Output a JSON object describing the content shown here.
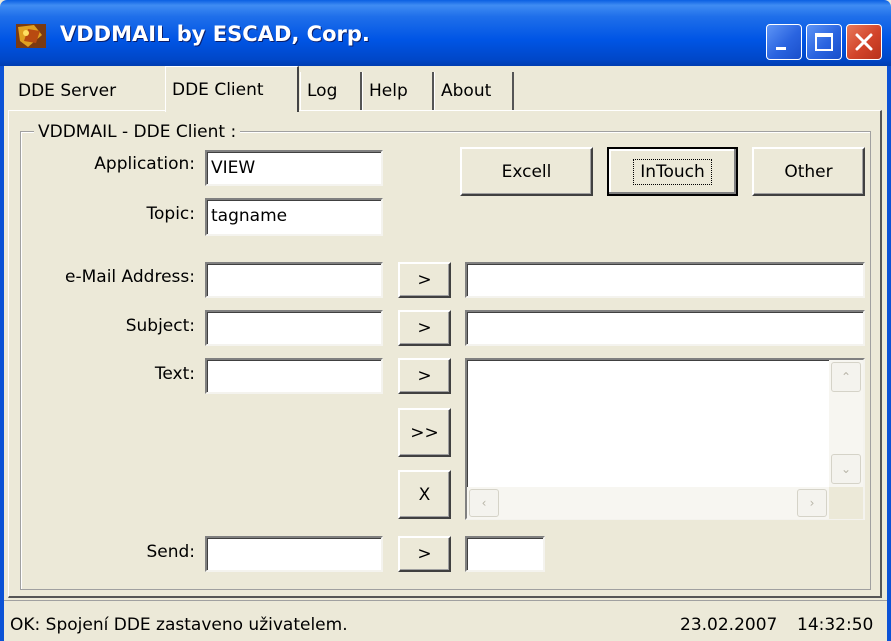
{
  "window": {
    "title": "VDDMAIL by ESCAD, Corp.",
    "buttons": {
      "minimize": "_",
      "maximize": "□",
      "close": "✕"
    }
  },
  "tabs": [
    {
      "label": "DDE Server",
      "active": false
    },
    {
      "label": "DDE Client",
      "active": true
    },
    {
      "label": "Log",
      "active": false
    },
    {
      "label": "Help",
      "active": false
    },
    {
      "label": "About",
      "active": false
    }
  ],
  "group_title": "VDDMAIL - DDE Client :",
  "form": {
    "application_label": "Application:",
    "application_value": "VIEW",
    "topic_label": "Topic:",
    "topic_value": "tagname",
    "email_label": "e-Mail Address:",
    "email_value": "",
    "subject_label": "Subject:",
    "subject_value": "",
    "text_label": "Text:",
    "text_value": "",
    "send_label": "Send:",
    "send_value": ""
  },
  "preset_buttons": {
    "excel": "Excell",
    "intouch": "InTouch",
    "other": "Other"
  },
  "arrow_buttons": {
    "single": ">",
    "double": ">>",
    "clear": "X"
  },
  "scroll_glyphs": {
    "up": "⌃",
    "down": "⌄",
    "left": "‹",
    "right": "›"
  },
  "status": {
    "message": "OK: Spojení DDE zastaveno uživatelem.",
    "date": "23.02.2007",
    "time": "14:32:50"
  },
  "colors": {
    "titlebar": "#0055E5",
    "window_bg": "#ECE9D8",
    "close_button": "#D2442A"
  }
}
